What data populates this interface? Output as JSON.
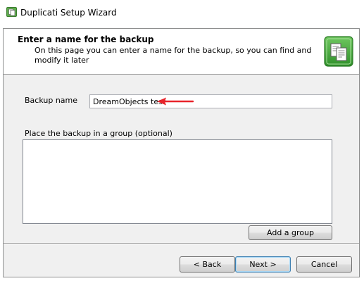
{
  "window": {
    "title": "Duplicati Setup Wizard",
    "icon": "duplicati-app-icon"
  },
  "header": {
    "title": "Enter a name for the backup",
    "description": "On this page you can enter a name for the backup, so you can find and modify it later",
    "icon": "document-copy-icon"
  },
  "form": {
    "backup_name_label": "Backup name",
    "backup_name_value": "DreamObjects test",
    "group_label": "Place the backup in a group (optional)",
    "add_group_label": "Add a group"
  },
  "footer": {
    "back_label": "< Back",
    "next_label": "Next >",
    "cancel_label": "Cancel"
  },
  "colors": {
    "annotation_arrow": "#e8242b",
    "icon_green": "#3aa935"
  }
}
